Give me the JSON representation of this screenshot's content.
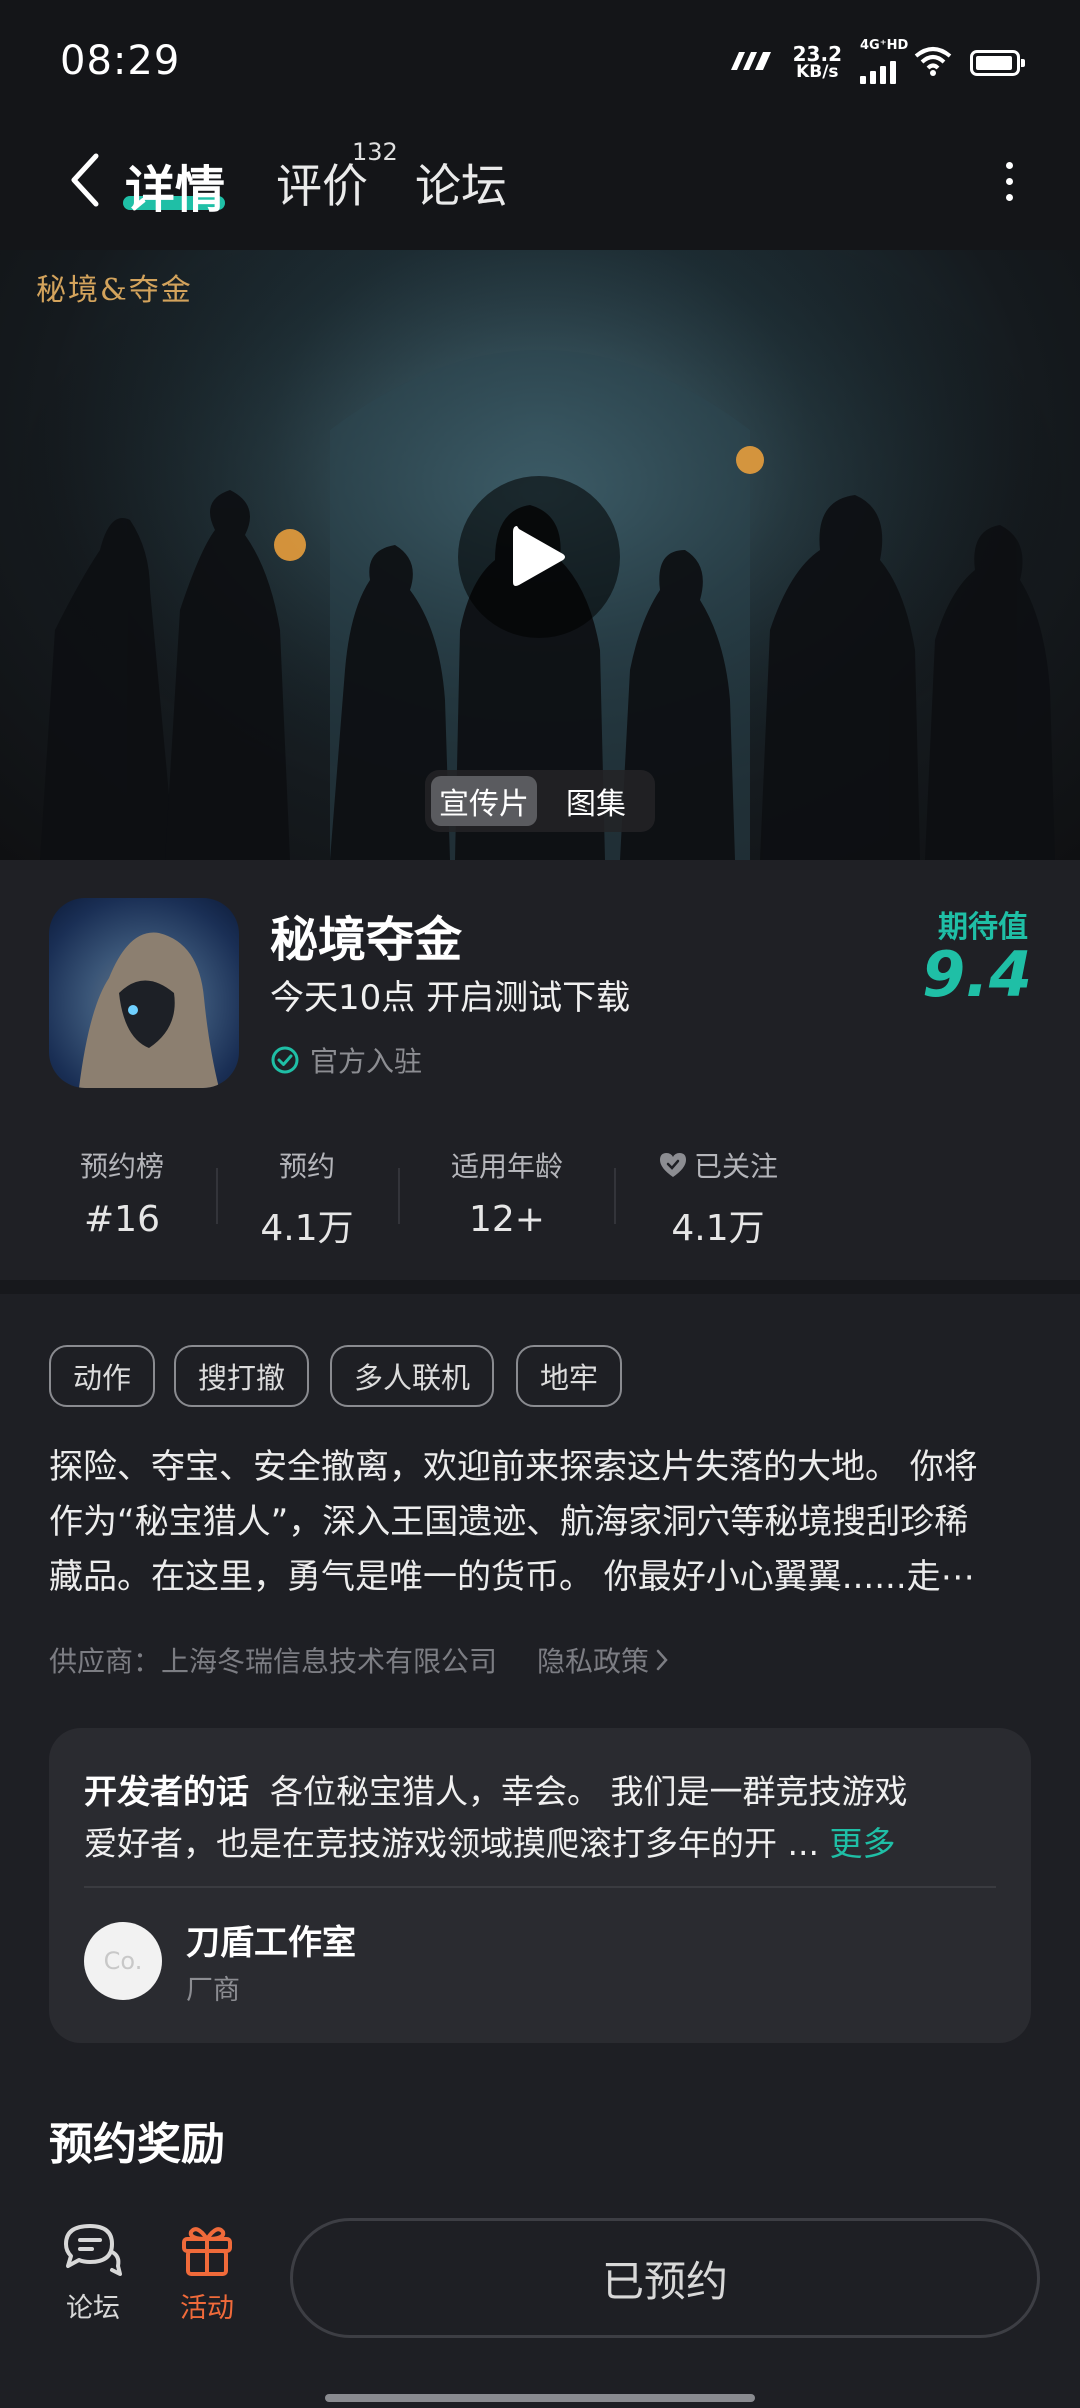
{
  "status_bar": {
    "time": "08:29",
    "net_speed": "23.2",
    "net_unit": "KB/s",
    "signal_tag": "4G⁺HD"
  },
  "header": {
    "tabs": [
      {
        "label": "详情",
        "active": true
      },
      {
        "label": "评价",
        "count": "132"
      },
      {
        "label": "论坛"
      }
    ]
  },
  "hero": {
    "logo_text": "秘境&夺金",
    "media_tabs": [
      {
        "label": "宣传片",
        "active": true
      },
      {
        "label": "图集"
      }
    ]
  },
  "game": {
    "title": "秘境夺金",
    "subtitle": "今天10点 开启测试下载",
    "official_badge": "官方入驻",
    "expect_label": "期待值",
    "expect_value": "9.4"
  },
  "stats": [
    {
      "label": "预约榜",
      "value": "#16"
    },
    {
      "label": "预约",
      "value": "4.1万"
    },
    {
      "label": "适用年龄",
      "value": "12+"
    },
    {
      "label": "已关注",
      "value": "4.1万"
    }
  ],
  "tags": [
    "动作",
    "搜打撤",
    "多人联机",
    "地牢"
  ],
  "description": [
    "探险、夺宝、安全撤离，欢迎前来探索这片失落的大地。 你将",
    "作为“秘宝猎人”，深入王国遗迹、航海家洞穴等秘境搜刮珍稀",
    "藏品。在这里，勇气是唯一的货币。 你最好小心翼翼......走⋯"
  ],
  "supplier": {
    "text": "供应商：上海冬瑞信息技术有限公司",
    "privacy_label": "隐私政策"
  },
  "developer": {
    "heading": "开发者的话",
    "line1": "各位秘宝猎人，幸会。 我们是一群竞技游戏",
    "line2": "爱好者，也是在竞技游戏领域摸爬滚打多年的开 ...",
    "more_label": "更多",
    "studio_avatar_text": "Co.",
    "studio_name": "刀盾工作室",
    "studio_role": "厂商"
  },
  "reward_section": {
    "title": "预约奖励"
  },
  "bottom_bar": {
    "forum_label": "论坛",
    "activity_label": "活动",
    "reserve_label": "已预约"
  },
  "colors": {
    "accent": "#1fbfa6",
    "activity": "#f06a3a",
    "background": "#1e1f24"
  }
}
